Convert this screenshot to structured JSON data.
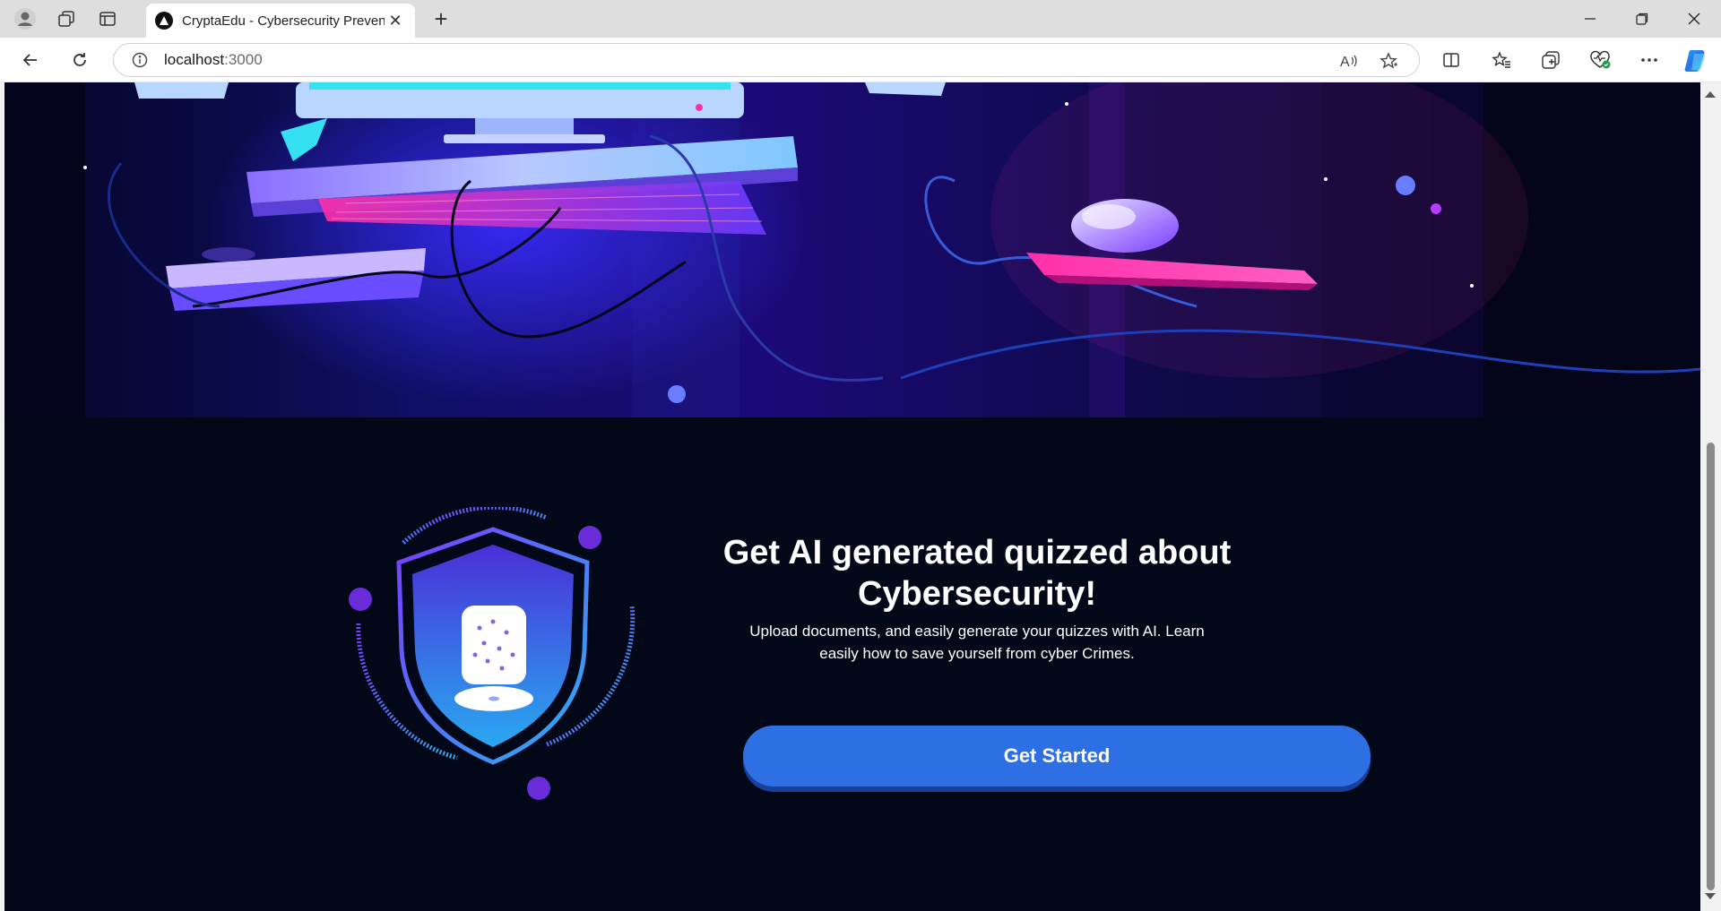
{
  "browser": {
    "tab_title": "CryptaEdu - Cybersecurity Preven",
    "address_host": "localhost",
    "address_port": ":3000",
    "new_tab_symbol": "+",
    "tab_close_symbol": "✕"
  },
  "page": {
    "headline": "Get AI generated quizzed about Cybersecurity!",
    "subtext": "Upload documents, and easily generate your quizzes with AI. Learn easily how to save yourself from cyber Crimes.",
    "cta_label": "Get Started"
  },
  "colors": {
    "page_bg": "#020817",
    "cta_button": "#2f6fe4",
    "hero_accent_pink": "#ff2fa8",
    "hero_accent_cyan": "#35e0f0"
  },
  "icons": [
    "profile-icon",
    "workspaces-icon",
    "tab-actions-icon",
    "back-icon",
    "refresh-icon",
    "info-icon",
    "read-aloud-icon",
    "favorite-star-icon",
    "split-screen-icon",
    "favorites-icon",
    "collections-icon",
    "browser-essentials-icon",
    "more-icon",
    "copilot-icon"
  ]
}
